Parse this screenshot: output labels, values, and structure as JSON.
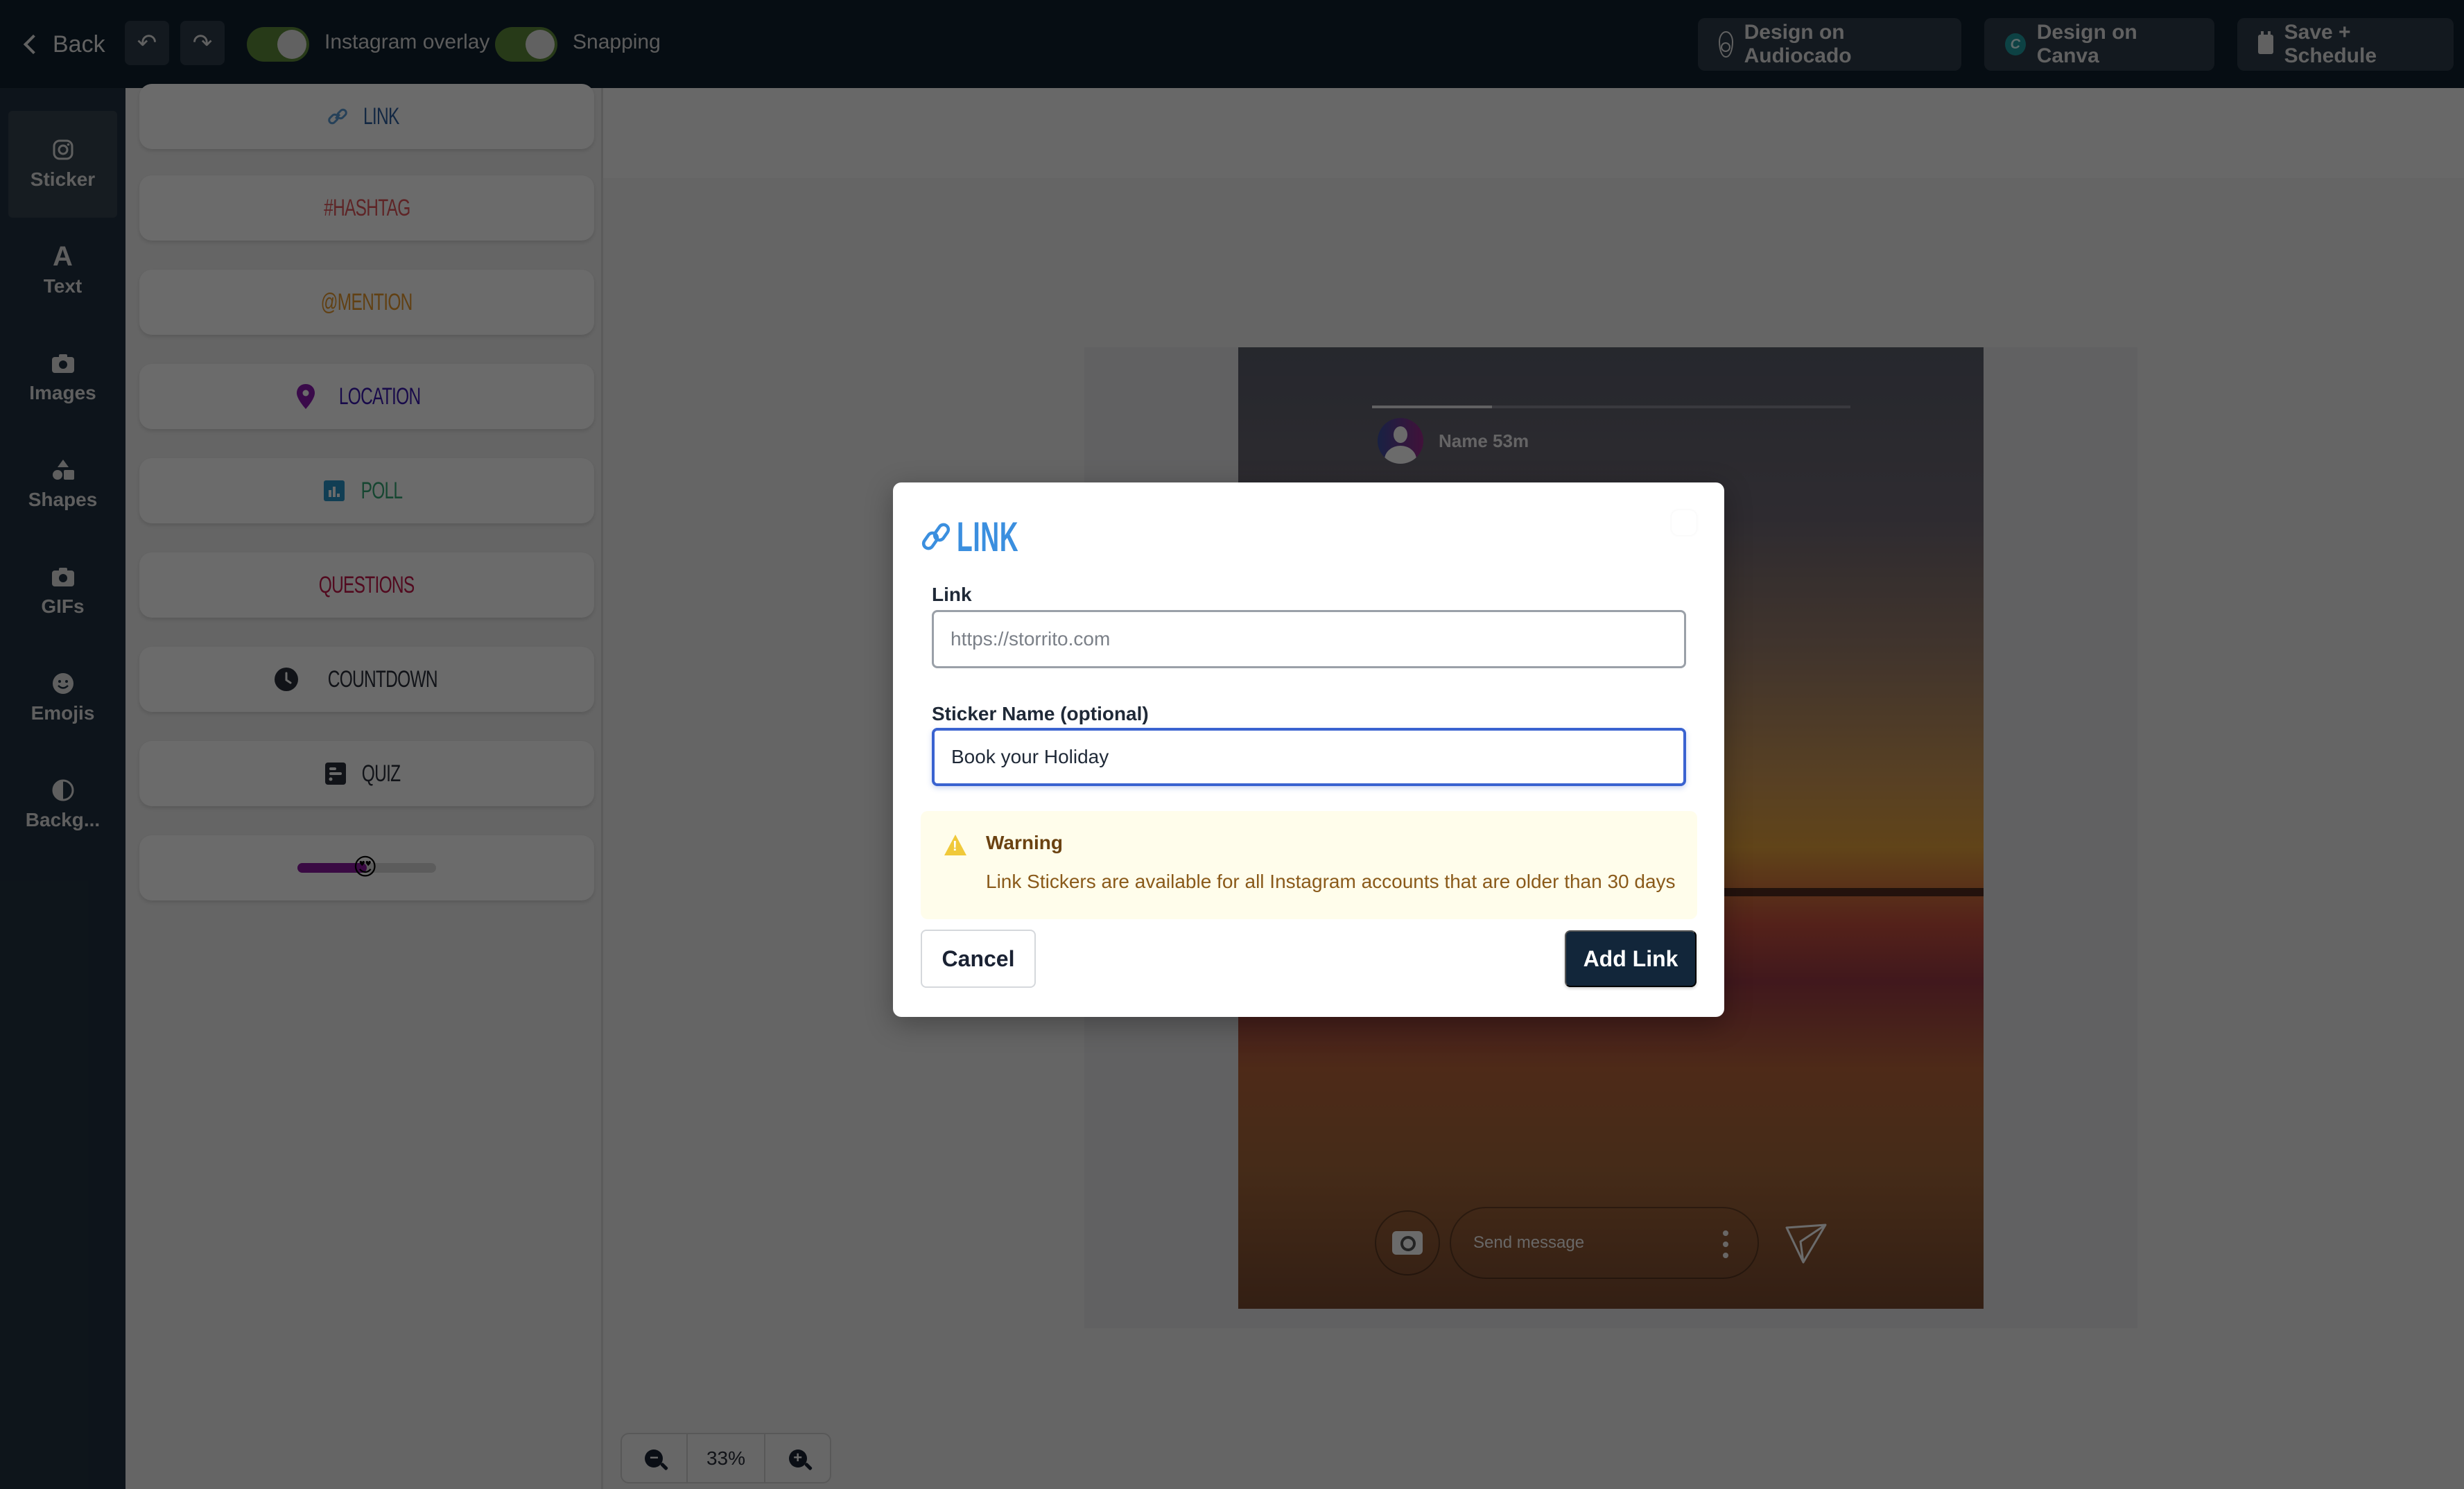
{
  "topbar": {
    "back_label": "Back",
    "undo_icon": "undo-icon",
    "redo_icon": "redo-icon",
    "toggles": [
      {
        "label": "Instagram overlay",
        "on": true
      },
      {
        "label": "Snapping",
        "on": true
      }
    ],
    "buttons": [
      {
        "label": "Design on Audiocado",
        "icon": "avocado-icon"
      },
      {
        "label": "Design on Canva",
        "icon": "canva-icon"
      },
      {
        "label": "Save + Schedule",
        "icon": "calendar-icon"
      }
    ],
    "canva_letter": "C"
  },
  "rail": {
    "items": [
      {
        "label": "Sticker",
        "icon": "instagram-icon",
        "active": true
      },
      {
        "label": "Text",
        "icon": "text-icon",
        "glyph": "A"
      },
      {
        "label": "Images",
        "icon": "camera-icon"
      },
      {
        "label": "Shapes",
        "icon": "shapes-icon"
      },
      {
        "label": "GIFs",
        "icon": "camera-icon"
      },
      {
        "label": "Emojis",
        "icon": "smiley-icon"
      },
      {
        "label": "Backg...",
        "icon": "contrast-icon"
      }
    ]
  },
  "stickers": {
    "items": [
      {
        "label": "LINK",
        "icon": "link-icon",
        "color": "#2f6fb0"
      },
      {
        "label": "#HASHTAG",
        "icon": "",
        "color": "#d9534f"
      },
      {
        "label": "@MENTION",
        "icon": "",
        "color": "#d98b2b"
      },
      {
        "label": "LOCATION",
        "icon": "location-pin-icon",
        "color": "#3a1aa0"
      },
      {
        "label": "POLL",
        "icon": "poll-icon",
        "color": "#2a9a6a"
      },
      {
        "label": "QUESTIONS",
        "icon": "",
        "color": "#b01e5a"
      },
      {
        "label": "COUNTDOWN",
        "icon": "clock-icon",
        "color": "#2a2f3a"
      },
      {
        "label": "QUIZ",
        "icon": "quiz-icon",
        "color": "#2a2f3a"
      }
    ],
    "emoji_slider": {
      "emoji": "😍",
      "value_percent": 50
    }
  },
  "story_preview": {
    "user_name": "Name 53m",
    "progress_percent": 25,
    "message_placeholder": "Send message"
  },
  "zoom": {
    "value": "33%"
  },
  "modal": {
    "title": "LINK",
    "link_label": "Link",
    "link_placeholder": "https://storrito.com",
    "link_value": "",
    "name_label": "Sticker Name (optional)",
    "name_value": "Book your Holiday",
    "warning_title": "Warning",
    "warning_text": "Link Stickers are available for all Instagram accounts that are older than 30 days",
    "cancel_label": "Cancel",
    "submit_label": "Add Link"
  },
  "colors": {
    "topbar_bg": "#0f1f2e",
    "accent_blue": "#3b8fdf",
    "primary_button": "#12263a",
    "focus_border": "#3a63d0",
    "warning_bg": "#fffdeb",
    "toggle_on": "#5e8a3a"
  }
}
